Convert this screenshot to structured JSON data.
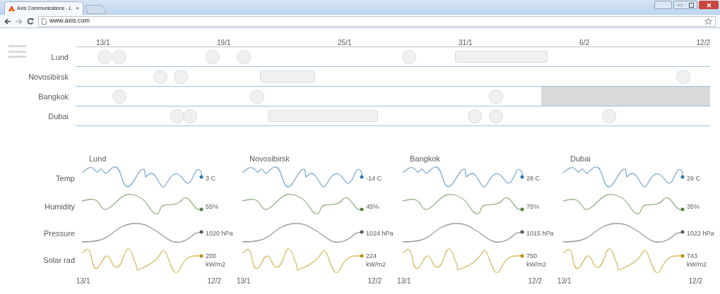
{
  "browser": {
    "tab": {
      "title": "Axis Communications - L",
      "close": "×"
    },
    "url": "www.axis.com"
  },
  "timeline": {
    "ticks": [
      "13/1",
      "19/1",
      "25/1",
      "31/1",
      "6/2",
      "12/2"
    ],
    "rows": [
      "Lund",
      "Novosibirsk",
      "Bangkok",
      "Dubai"
    ]
  },
  "weather": {
    "metrics": [
      {
        "label": "Temp",
        "color": "#2e75b6"
      },
      {
        "label": "Humidity",
        "color": "#548235"
      },
      {
        "label": "Pressure",
        "color": "#595959"
      },
      {
        "label": "Solar rad",
        "color": "#bf9000"
      }
    ],
    "cities": [
      {
        "name": "Lund",
        "readings": [
          "3 C",
          "55%",
          "1020 hPa",
          "200 kW/m2"
        ],
        "range_start": "13/1",
        "range_end": "12/2"
      },
      {
        "name": "Novosibirsk",
        "readings": [
          "-14 C",
          "45%",
          "1024 hPa",
          "224 kW/m2"
        ],
        "range_start": "13/1",
        "range_end": "12/2"
      },
      {
        "name": "Bangkok",
        "readings": [
          "28 C",
          "75%",
          "1015 hPa",
          "750 kW/m2"
        ],
        "range_start": "13/1",
        "range_end": "12/2"
      },
      {
        "name": "Dubai",
        "readings": [
          "29 C",
          "35%",
          "1022 hPa",
          "743 kW/m2"
        ],
        "range_start": "13/1",
        "range_end": "12/2"
      }
    ]
  }
}
